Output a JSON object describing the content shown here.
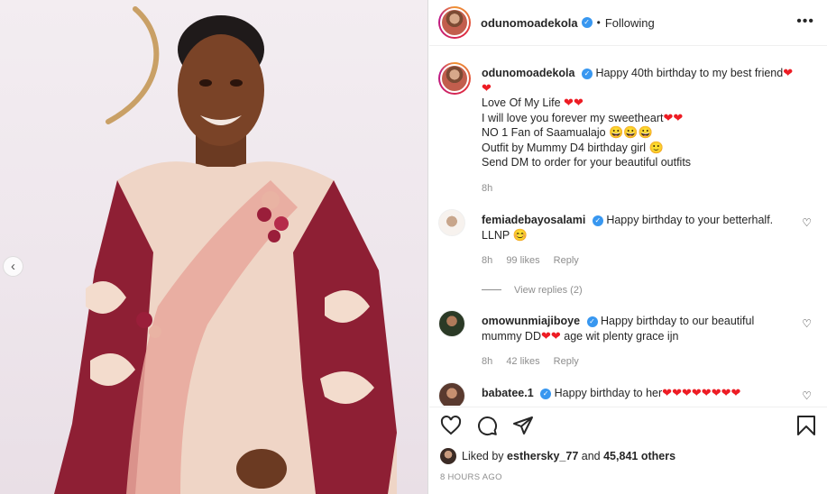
{
  "post": {
    "username": "odunomoadekola",
    "follow_state": "Following",
    "separator": "•",
    "more_label": "•••"
  },
  "caption": {
    "username": "odunomoadekola",
    "lines": [
      "Happy 40th birthday to my best friend",
      "Love Of My Life",
      "I will love you forever my sweetheart",
      "NO 1 Fan of Saamualajo",
      "Outfit by Mummy D4 birthday girl",
      "Send DM to order for your beautiful outfits"
    ],
    "time": "8h"
  },
  "comments": [
    {
      "username": "femiadebayosalami",
      "text": "Happy birthday to your betterhalf. LLNP",
      "time": "8h",
      "likes": "99 likes",
      "reply": "Reply",
      "view_replies": "View replies (2)"
    },
    {
      "username": "omowunmiajiboye",
      "text_a": "Happy birthday to our beautiful mummy DD",
      "text_b": "age wit plenty grace ijn",
      "time": "8h",
      "likes": "42 likes",
      "reply": "Reply"
    },
    {
      "username": "babatee.1",
      "text": "Happy birthday to her"
    }
  ],
  "footer": {
    "liked_prefix": "Liked by",
    "liked_user": "esthersky_77",
    "liked_and": "and",
    "liked_count": "45,841 others",
    "time_ago": "8 HOURS AGO"
  },
  "glyphs": {
    "heart": "❤",
    "grin": "😀",
    "smile": "🙂",
    "blush": "😊",
    "check": "✓",
    "chev_left": "‹",
    "heart_outline": "♡"
  },
  "colors": {
    "verified": "#3897f0",
    "heart_red": "#ed1c24",
    "meta_gray": "#8e8e8e"
  }
}
